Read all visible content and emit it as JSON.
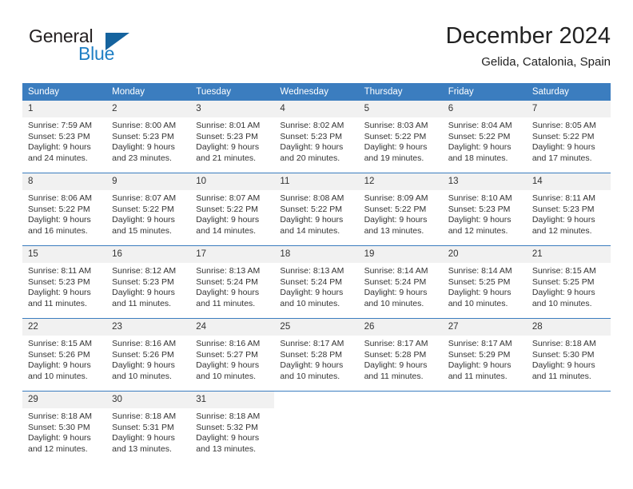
{
  "brand": {
    "word_top": "General",
    "word_bottom": "Blue",
    "triangle_color": "#15639e",
    "blue_color": "#1f7fc4"
  },
  "header": {
    "title": "December 2024",
    "subtitle": "Gelida, Catalonia, Spain"
  },
  "theme": {
    "header_blue": "#3b7dbf",
    "daynum_band": "#f1f1f1",
    "text": "#333333"
  },
  "weekday_headers": [
    "Sunday",
    "Monday",
    "Tuesday",
    "Wednesday",
    "Thursday",
    "Friday",
    "Saturday"
  ],
  "weeks": [
    [
      {
        "day": "1",
        "sunrise": "Sunrise: 7:59 AM",
        "sunset": "Sunset: 5:23 PM",
        "daylight1": "Daylight: 9 hours",
        "daylight2": "and 24 minutes."
      },
      {
        "day": "2",
        "sunrise": "Sunrise: 8:00 AM",
        "sunset": "Sunset: 5:23 PM",
        "daylight1": "Daylight: 9 hours",
        "daylight2": "and 23 minutes."
      },
      {
        "day": "3",
        "sunrise": "Sunrise: 8:01 AM",
        "sunset": "Sunset: 5:23 PM",
        "daylight1": "Daylight: 9 hours",
        "daylight2": "and 21 minutes."
      },
      {
        "day": "4",
        "sunrise": "Sunrise: 8:02 AM",
        "sunset": "Sunset: 5:23 PM",
        "daylight1": "Daylight: 9 hours",
        "daylight2": "and 20 minutes."
      },
      {
        "day": "5",
        "sunrise": "Sunrise: 8:03 AM",
        "sunset": "Sunset: 5:22 PM",
        "daylight1": "Daylight: 9 hours",
        "daylight2": "and 19 minutes."
      },
      {
        "day": "6",
        "sunrise": "Sunrise: 8:04 AM",
        "sunset": "Sunset: 5:22 PM",
        "daylight1": "Daylight: 9 hours",
        "daylight2": "and 18 minutes."
      },
      {
        "day": "7",
        "sunrise": "Sunrise: 8:05 AM",
        "sunset": "Sunset: 5:22 PM",
        "daylight1": "Daylight: 9 hours",
        "daylight2": "and 17 minutes."
      }
    ],
    [
      {
        "day": "8",
        "sunrise": "Sunrise: 8:06 AM",
        "sunset": "Sunset: 5:22 PM",
        "daylight1": "Daylight: 9 hours",
        "daylight2": "and 16 minutes."
      },
      {
        "day": "9",
        "sunrise": "Sunrise: 8:07 AM",
        "sunset": "Sunset: 5:22 PM",
        "daylight1": "Daylight: 9 hours",
        "daylight2": "and 15 minutes."
      },
      {
        "day": "10",
        "sunrise": "Sunrise: 8:07 AM",
        "sunset": "Sunset: 5:22 PM",
        "daylight1": "Daylight: 9 hours",
        "daylight2": "and 14 minutes."
      },
      {
        "day": "11",
        "sunrise": "Sunrise: 8:08 AM",
        "sunset": "Sunset: 5:22 PM",
        "daylight1": "Daylight: 9 hours",
        "daylight2": "and 14 minutes."
      },
      {
        "day": "12",
        "sunrise": "Sunrise: 8:09 AM",
        "sunset": "Sunset: 5:22 PM",
        "daylight1": "Daylight: 9 hours",
        "daylight2": "and 13 minutes."
      },
      {
        "day": "13",
        "sunrise": "Sunrise: 8:10 AM",
        "sunset": "Sunset: 5:23 PM",
        "daylight1": "Daylight: 9 hours",
        "daylight2": "and 12 minutes."
      },
      {
        "day": "14",
        "sunrise": "Sunrise: 8:11 AM",
        "sunset": "Sunset: 5:23 PM",
        "daylight1": "Daylight: 9 hours",
        "daylight2": "and 12 minutes."
      }
    ],
    [
      {
        "day": "15",
        "sunrise": "Sunrise: 8:11 AM",
        "sunset": "Sunset: 5:23 PM",
        "daylight1": "Daylight: 9 hours",
        "daylight2": "and 11 minutes."
      },
      {
        "day": "16",
        "sunrise": "Sunrise: 8:12 AM",
        "sunset": "Sunset: 5:23 PM",
        "daylight1": "Daylight: 9 hours",
        "daylight2": "and 11 minutes."
      },
      {
        "day": "17",
        "sunrise": "Sunrise: 8:13 AM",
        "sunset": "Sunset: 5:24 PM",
        "daylight1": "Daylight: 9 hours",
        "daylight2": "and 11 minutes."
      },
      {
        "day": "18",
        "sunrise": "Sunrise: 8:13 AM",
        "sunset": "Sunset: 5:24 PM",
        "daylight1": "Daylight: 9 hours",
        "daylight2": "and 10 minutes."
      },
      {
        "day": "19",
        "sunrise": "Sunrise: 8:14 AM",
        "sunset": "Sunset: 5:24 PM",
        "daylight1": "Daylight: 9 hours",
        "daylight2": "and 10 minutes."
      },
      {
        "day": "20",
        "sunrise": "Sunrise: 8:14 AM",
        "sunset": "Sunset: 5:25 PM",
        "daylight1": "Daylight: 9 hours",
        "daylight2": "and 10 minutes."
      },
      {
        "day": "21",
        "sunrise": "Sunrise: 8:15 AM",
        "sunset": "Sunset: 5:25 PM",
        "daylight1": "Daylight: 9 hours",
        "daylight2": "and 10 minutes."
      }
    ],
    [
      {
        "day": "22",
        "sunrise": "Sunrise: 8:15 AM",
        "sunset": "Sunset: 5:26 PM",
        "daylight1": "Daylight: 9 hours",
        "daylight2": "and 10 minutes."
      },
      {
        "day": "23",
        "sunrise": "Sunrise: 8:16 AM",
        "sunset": "Sunset: 5:26 PM",
        "daylight1": "Daylight: 9 hours",
        "daylight2": "and 10 minutes."
      },
      {
        "day": "24",
        "sunrise": "Sunrise: 8:16 AM",
        "sunset": "Sunset: 5:27 PM",
        "daylight1": "Daylight: 9 hours",
        "daylight2": "and 10 minutes."
      },
      {
        "day": "25",
        "sunrise": "Sunrise: 8:17 AM",
        "sunset": "Sunset: 5:28 PM",
        "daylight1": "Daylight: 9 hours",
        "daylight2": "and 10 minutes."
      },
      {
        "day": "26",
        "sunrise": "Sunrise: 8:17 AM",
        "sunset": "Sunset: 5:28 PM",
        "daylight1": "Daylight: 9 hours",
        "daylight2": "and 11 minutes."
      },
      {
        "day": "27",
        "sunrise": "Sunrise: 8:17 AM",
        "sunset": "Sunset: 5:29 PM",
        "daylight1": "Daylight: 9 hours",
        "daylight2": "and 11 minutes."
      },
      {
        "day": "28",
        "sunrise": "Sunrise: 8:18 AM",
        "sunset": "Sunset: 5:30 PM",
        "daylight1": "Daylight: 9 hours",
        "daylight2": "and 11 minutes."
      }
    ],
    [
      {
        "day": "29",
        "sunrise": "Sunrise: 8:18 AM",
        "sunset": "Sunset: 5:30 PM",
        "daylight1": "Daylight: 9 hours",
        "daylight2": "and 12 minutes."
      },
      {
        "day": "30",
        "sunrise": "Sunrise: 8:18 AM",
        "sunset": "Sunset: 5:31 PM",
        "daylight1": "Daylight: 9 hours",
        "daylight2": "and 13 minutes."
      },
      {
        "day": "31",
        "sunrise": "Sunrise: 8:18 AM",
        "sunset": "Sunset: 5:32 PM",
        "daylight1": "Daylight: 9 hours",
        "daylight2": "and 13 minutes."
      },
      {
        "day": "",
        "sunrise": "",
        "sunset": "",
        "daylight1": "",
        "daylight2": ""
      },
      {
        "day": "",
        "sunrise": "",
        "sunset": "",
        "daylight1": "",
        "daylight2": ""
      },
      {
        "day": "",
        "sunrise": "",
        "sunset": "",
        "daylight1": "",
        "daylight2": ""
      },
      {
        "day": "",
        "sunrise": "",
        "sunset": "",
        "daylight1": "",
        "daylight2": ""
      }
    ]
  ]
}
